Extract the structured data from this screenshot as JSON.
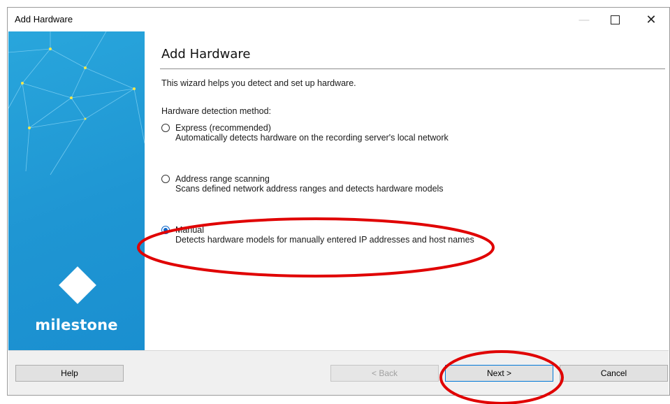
{
  "window": {
    "title": "Add Hardware",
    "controls": {
      "minimize": "—",
      "close": "✕"
    }
  },
  "sidebar": {
    "brand": "milestone",
    "accent_color": "#1f96d3"
  },
  "content": {
    "heading": "Add Hardware",
    "intro": "This wizard helps you detect and set up hardware.",
    "method_label": "Hardware detection method:",
    "options": [
      {
        "title": "Express (recommended)",
        "description": "Automatically detects hardware on the recording server's local network",
        "selected": false
      },
      {
        "title": "Address range scanning",
        "description": "Scans defined network address ranges and detects hardware models",
        "selected": false
      },
      {
        "title": "Manual",
        "description": "Detects hardware models for manually entered IP addresses and host names",
        "selected": true
      }
    ]
  },
  "footer": {
    "help_label": "Help",
    "back_label": "< Back",
    "next_label": "Next >",
    "cancel_label": "Cancel"
  },
  "annotation_color": "#e00000"
}
